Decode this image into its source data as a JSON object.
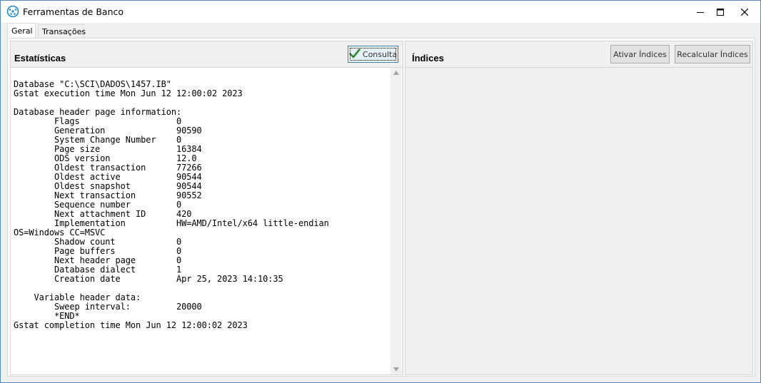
{
  "window": {
    "title": "Ferramentas de Banco",
    "icon": "app-dots-icon",
    "controls": [
      "minimize-icon",
      "maximize-icon",
      "close-icon"
    ]
  },
  "tabs": [
    {
      "label": "Geral",
      "active": true
    },
    {
      "label": "Transações",
      "active": false
    }
  ],
  "left_panel": {
    "title": "Estatísticas",
    "consulta_label": "Consulta",
    "stats_text": "Database \"C:\\SCI\\DADOS\\1457.IB\"\nGstat execution time Mon Jun 12 12:00:02 2023\n\nDatabase header page information:\n\tFlags\t\t\t0\n\tGeneration\t\t90590\n\tSystem Change Number\t0\n\tPage size\t\t16384\n\tODS version\t\t12.0\n\tOldest transaction\t77266\n\tOldest active\t\t90544\n\tOldest snapshot\t\t90544\n\tNext transaction\t90552\n\tSequence number\t\t0\n\tNext attachment ID\t420\n\tImplementation\t\tHW=AMD/Intel/x64 little-endian\nOS=Windows CC=MSVC\n\tShadow count\t\t0\n\tPage buffers\t\t0\n\tNext header page\t0\n\tDatabase dialect\t1\n\tCreation date\t\tApr 25, 2023 14:10:35\n\n    Variable header data:\n\tSweep interval:\t\t20000\n\t*END*\nGstat completion time Mon Jun 12 12:00:02 2023"
  },
  "right_panel": {
    "title": "Índices",
    "ativar_label": "Ativar Índices",
    "recalcular_label": "Recalcular Índices"
  },
  "colors": {
    "window_border": "#5a87b8",
    "check_green": "#2e8b2e",
    "focus_border": "#3c7fb1"
  }
}
